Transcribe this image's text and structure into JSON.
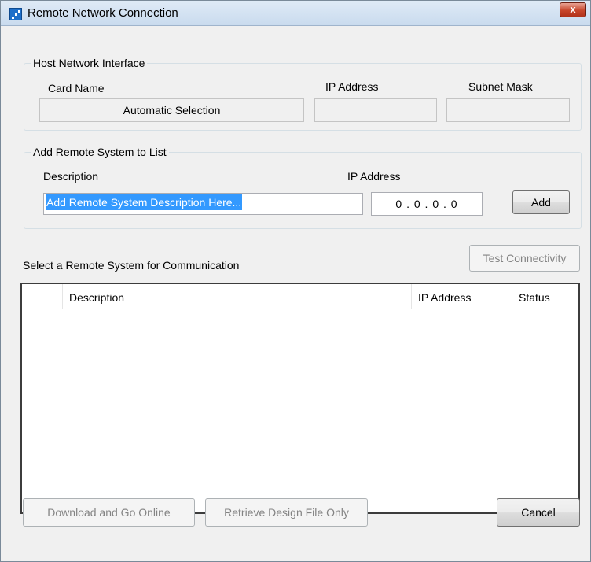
{
  "window": {
    "title": "Remote Network Connection",
    "close_glyph": "x"
  },
  "host_group": {
    "legend": "Host Network Interface",
    "card_name_label": "Card Name",
    "ip_address_label": "IP Address",
    "subnet_mask_label": "Subnet Mask",
    "card_name_value": "Automatic Selection",
    "ip_address_value": "",
    "subnet_mask_value": ""
  },
  "add_group": {
    "legend": "Add Remote System to List",
    "description_label": "Description",
    "ip_address_label": "IP Address",
    "description_value": "Add Remote System Description Here...",
    "ip_value": "0 . 0 . 0 . 0",
    "add_button": "Add"
  },
  "remote_list": {
    "section_label": "Select a Remote System for Communication",
    "test_button": "Test Connectivity",
    "columns": [
      "",
      "Description",
      "IP Address",
      "Status"
    ],
    "rows": []
  },
  "footer": {
    "download_button": "Download and Go Online",
    "retrieve_button": "Retrieve Design File Only",
    "cancel_button": "Cancel"
  },
  "colors": {
    "selection": "#3399ff",
    "close_button": "#c7462b",
    "titlebar": "#c9dbee"
  },
  "icons": {
    "app": "network-app-icon",
    "close": "close-icon"
  }
}
